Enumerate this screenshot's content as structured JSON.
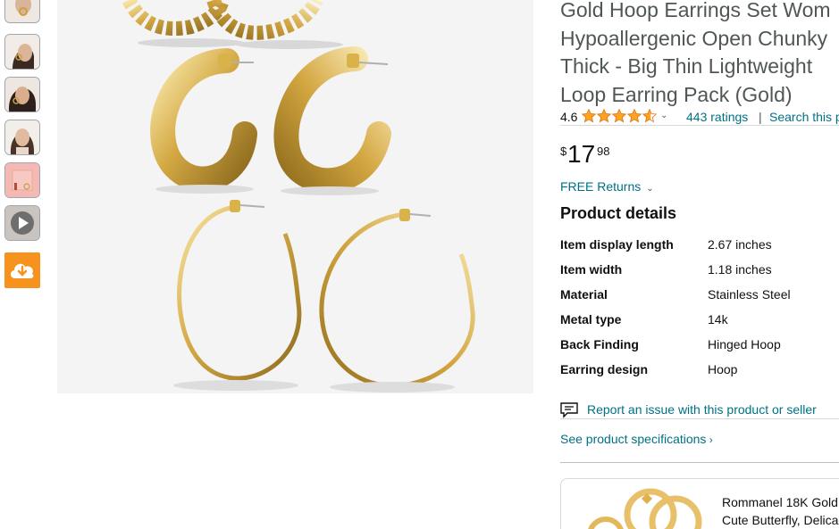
{
  "thumbnails": [
    {
      "icon": "earring-thumbnail-1"
    },
    {
      "icon": "model-thumbnail-1"
    },
    {
      "icon": "model-thumbnail-2"
    },
    {
      "icon": "model-thumbnail-3"
    },
    {
      "icon": "package-thumbnail"
    },
    {
      "icon": "video-thumbnail"
    }
  ],
  "download_icon": "cloud-download-icon",
  "product": {
    "title_lines": [
      "Gold Hoop Earrings Set Wom",
      "Hypoallergenic Open Chunky",
      "Thick - Big Thin Lightweight",
      "Loop Earring Pack (Gold)"
    ],
    "rating_value": "4.6",
    "rating_fraction": 0.92,
    "ratings_count": "443 ratings",
    "separator": "|",
    "search_link": "Search this p",
    "price": {
      "symbol": "$",
      "whole": "17",
      "fraction": "98"
    },
    "returns": "FREE Returns",
    "details_heading": "Product details",
    "details": [
      {
        "key": "Item display length",
        "value": "2.67 inches"
      },
      {
        "key": "Item width",
        "value": "1.18 inches"
      },
      {
        "key": "Material",
        "value": "Stainless Steel"
      },
      {
        "key": "Metal type",
        "value": "14k"
      },
      {
        "key": "Back Finding",
        "value": "Hinged Hoop"
      },
      {
        "key": "Earring design",
        "value": "Hoop"
      }
    ],
    "report_link": "Report an issue with this product or seller",
    "spec_link": "See product specifications",
    "recommendation_lines": [
      "Rommanel 18K Gold",
      "Cute Butterfly, Delica"
    ]
  },
  "colors": {
    "link": "#007185",
    "star": "#ffa41c",
    "download": "#f7921e",
    "gold": "#d9b24a"
  }
}
